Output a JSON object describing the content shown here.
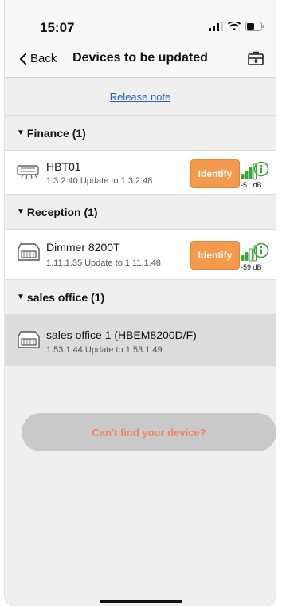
{
  "status": {
    "time": "15:07"
  },
  "nav": {
    "back_label": "Back",
    "title": "Devices to be updated"
  },
  "release_note": "Release note",
  "groups": [
    {
      "label": "Finance (1)",
      "devices": [
        {
          "name": "HBT01",
          "version": "1.3.2.40 Update to 1.3.2.48",
          "identify_label": "Identify",
          "signal_db": "-51 dB"
        }
      ]
    },
    {
      "label": "Reception (1)",
      "devices": [
        {
          "name": "Dimmer 8200T",
          "version": "1.11.1.35 Update to 1.11.1.48",
          "identify_label": "Identify",
          "signal_db": "-59 dB"
        }
      ]
    },
    {
      "label": "sales office (1)",
      "devices": [
        {
          "name": "sales office 1 (HBEM8200D/F)",
          "version": "1.53.1.44 Update to 1.53.1.49"
        }
      ]
    }
  ],
  "cant_find_label": "Can't find your device?",
  "icons": {
    "back": "chevron-left-icon",
    "toolbox": "toolbox-icon",
    "signal": "signal-strength-icon",
    "info": "info-icon",
    "device": "device-icon"
  },
  "colors": {
    "identify": "#f39a4c",
    "signal": "#3aa63a",
    "link": "#2c5fb5",
    "cant_find_text": "#f08566"
  }
}
